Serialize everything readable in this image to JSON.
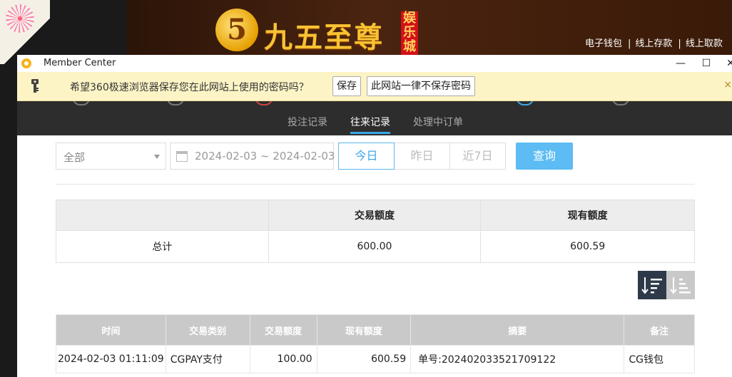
{
  "site": {
    "logo_number": "5",
    "logo_text": "九五至尊",
    "logo_badge": "娱乐城",
    "links": [
      "电子钱包",
      "线上存款",
      "线上取款"
    ]
  },
  "window": {
    "title": "Member Center",
    "controls": {
      "minimize": "—",
      "maximize": "☐",
      "close": "✕"
    }
  },
  "password_bar": {
    "message": "希望360极速浏览器保存您在此网站上使用的密码吗？",
    "save_label": "保存",
    "never_label": "此网站一律不保存密码",
    "close": "×"
  },
  "tabs": [
    {
      "label": "投注记录",
      "active": false
    },
    {
      "label": "往来记录",
      "active": true
    },
    {
      "label": "处理中订单",
      "active": false
    }
  ],
  "filters": {
    "type_select": "全部",
    "date_range": "2024-02-03 ~ 2024-02-03",
    "quick_ranges": [
      "今日",
      "昨日",
      "近7日"
    ],
    "active_range": "今日",
    "query_label": "查询"
  },
  "summary": {
    "headers": [
      "",
      "交易额度",
      "现有额度"
    ],
    "row": {
      "label": "总计",
      "amount": "600.00",
      "balance": "600.59"
    }
  },
  "records": {
    "headers": [
      "时间",
      "交易类别",
      "交易额度",
      "现有额度",
      "摘要",
      "备注"
    ],
    "rows": [
      {
        "time": "2024-02-03 01:11:09",
        "type": "CGPAY支付",
        "amount": "100.00",
        "balance": "600.59",
        "summary": "单号:202402033521709122",
        "note": "CG钱包"
      }
    ]
  },
  "colors": {
    "accent": "#39a7e6",
    "query_button": "#5cbcf3",
    "nav_dark": "#2d2d2d",
    "table_header": "#c9c9c9"
  }
}
